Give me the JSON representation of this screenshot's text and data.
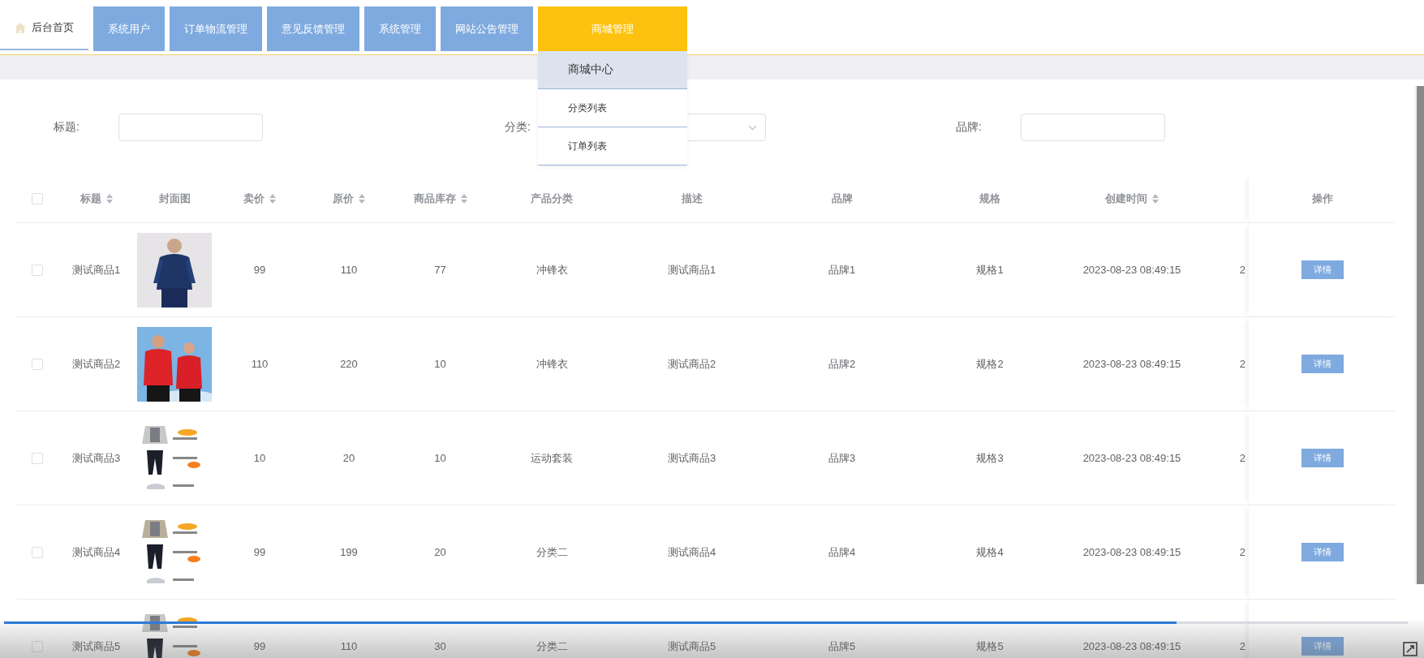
{
  "nav": {
    "tabs": [
      {
        "label": "后台首页",
        "kind": "home",
        "selected": true
      },
      {
        "label": "系统用户",
        "kind": "button",
        "selected": false
      },
      {
        "label": "订单物流管理",
        "kind": "button",
        "selected": false
      },
      {
        "label": "意见反馈管理",
        "kind": "button",
        "selected": false
      },
      {
        "label": "系统管理",
        "kind": "button",
        "selected": false
      },
      {
        "label": "网站公告管理",
        "kind": "button",
        "selected": false
      },
      {
        "label": "商城管理",
        "kind": "button",
        "selected": false,
        "expanded": true,
        "menu": [
          {
            "label": "商城中心",
            "selected": true
          },
          {
            "label": "分类列表",
            "selected": false
          },
          {
            "label": "订单列表",
            "selected": false
          }
        ]
      }
    ]
  },
  "search": {
    "fields": [
      {
        "label": "标题:",
        "kind": "input"
      },
      {
        "label": "分类:",
        "kind": "select"
      },
      {
        "label": "品牌:",
        "kind": "input"
      }
    ]
  },
  "table": {
    "columns": [
      {
        "label": "标题",
        "sortable": true
      },
      {
        "label": "封面图",
        "sortable": false
      },
      {
        "label": "卖价",
        "sortable": true
      },
      {
        "label": "原价",
        "sortable": true
      },
      {
        "label": "商品库存",
        "sortable": true
      },
      {
        "label": "产品分类",
        "sortable": false
      },
      {
        "label": "描述",
        "sortable": false
      },
      {
        "label": "品牌",
        "sortable": false
      },
      {
        "label": "规格",
        "sortable": false
      },
      {
        "label": "创建时间",
        "sortable": true
      },
      {
        "sortable": false
      },
      {
        "label": "操作",
        "sortable": false
      }
    ],
    "header_checked": false,
    "rows": [
      {
        "checked": false,
        "cells": [
          "测试商品1",
          {
            "kind": "picture"
          },
          "99",
          "110",
          "77",
          "冲锋衣",
          "测试商品1",
          "品牌1",
          "规格1",
          "2023-08-23 08:49:15",
          "2"
        ],
        "action": "详情"
      },
      {
        "checked": false,
        "cells": [
          "测试商品2",
          {
            "kind": "picture"
          },
          "110",
          "220",
          "10",
          "冲锋衣",
          "测试商品2",
          "品牌2",
          "规格2",
          "2023-08-23 08:49:15",
          "2"
        ],
        "action": "详情"
      },
      {
        "checked": false,
        "cells": [
          "测试商品3",
          {
            "kind": "picture"
          },
          "10",
          "20",
          "10",
          "运动套装",
          "测试商品3",
          "品牌3",
          "规格3",
          "2023-08-23 08:49:15",
          "2"
        ],
        "action": "详情"
      },
      {
        "checked": false,
        "cells": [
          "测试商品4",
          {
            "kind": "picture"
          },
          "99",
          "199",
          "20",
          "分类二",
          "测试商品4",
          "品牌4",
          "规格4",
          "2023-08-23 08:49:15",
          "2"
        ],
        "action": "详情"
      },
      {
        "checked": false,
        "cells": [
          "测试商品5",
          {
            "kind": "picture"
          },
          "99",
          "110",
          "30",
          "分类二",
          "测试商品5",
          "品牌5",
          "规格5",
          "2023-08-23 08:49:15",
          "2"
        ],
        "action": "详情"
      }
    ]
  },
  "player": {
    "level": 0.835
  }
}
